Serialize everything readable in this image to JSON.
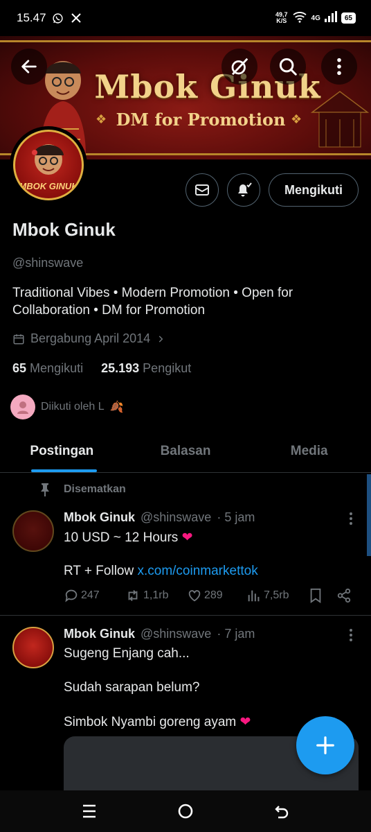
{
  "status_bar": {
    "time": "15.47",
    "net_speed_value": "49,7",
    "net_speed_unit": "K/S",
    "network": "4G",
    "battery": "65"
  },
  "banner": {
    "title": "Mbok Ginuk",
    "subtitle": "DM for Promotion",
    "avatar_text": "MBOK GINUK"
  },
  "profile": {
    "name": "Mbok Ginuk",
    "handle": "@shinswave",
    "bio": "Traditional Vibes • Modern Promotion • Open for Collaboration • DM for Promotion",
    "joined": "Bergabung April 2014",
    "following_count": "65",
    "following_label": "Mengikuti",
    "followers_count": "25.193",
    "followers_label": "Pengikut",
    "followed_by": "Diikuti oleh L",
    "follow_button": "Mengikuti"
  },
  "tabs": [
    {
      "label": "Postingan",
      "active": true
    },
    {
      "label": "Balasan",
      "active": false
    },
    {
      "label": "Media",
      "active": false
    }
  ],
  "posts": [
    {
      "pinned_label": "Disematkan",
      "name": "Mbok Ginuk",
      "handle": "@shinswave",
      "time": "· 5 jam",
      "line1": "10 USD ~ 12 Hours",
      "line2_prefix": "RT + Follow ",
      "line2_link": "x.com/coinmarkettok",
      "replies": "247",
      "reposts": "1,1rb",
      "likes": "289",
      "views": "7,5rb"
    },
    {
      "name": "Mbok Ginuk",
      "handle": "@shinswave",
      "time": "· 7 jam",
      "line1": "Sugeng Enjang cah...",
      "line2": "Sudah sarapan belum?",
      "line3": "Simbok Nyambi goreng ayam"
    }
  ],
  "colors": {
    "accent": "#1d9bf0",
    "background": "#000000",
    "muted_text": "#71767b",
    "heart": "#f91880"
  }
}
